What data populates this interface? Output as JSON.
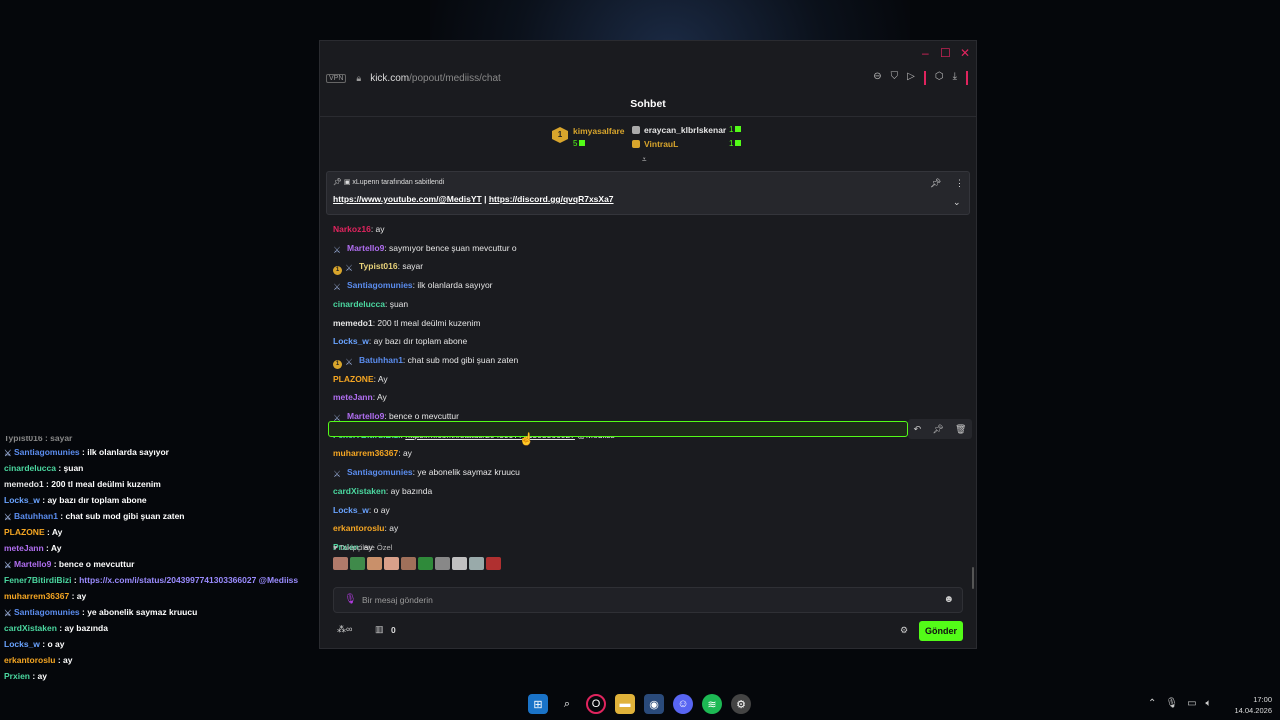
{
  "browser": {
    "vpn_label": "VPN",
    "url_domain": "kick.com",
    "url_path": "/popout/mediiss/chat"
  },
  "chat": {
    "title": "Sohbet",
    "leaderboard": [
      {
        "name": "kimyasalfare",
        "count": "5",
        "color": "#d8a52c"
      },
      {
        "name": "eraycan_klbrlskenar",
        "count": "1",
        "color": "#e6e6e6"
      },
      {
        "name": "VintrauL",
        "count": "1",
        "color": "#d8a52c"
      }
    ],
    "leaderboard_rank": "1",
    "pinned": {
      "by": "xLupenn tarafından sabitlendi",
      "link1": "https://www.youtube.com/@MedisYT",
      "separator": "|",
      "link2": "https://discord.gg/qvqR7xsXa7"
    },
    "messages": [
      {
        "user": "Narkoz16",
        "color": "#e0245e",
        "text": ": ay",
        "badges": []
      },
      {
        "user": "Martello9",
        "color": "#b06ef0",
        "text": ": saymıyor bence şuan mevcuttur o",
        "badges": [
          "mod"
        ]
      },
      {
        "user": "Typist016",
        "color": "#e8d27a",
        "text": ": sayar",
        "badges": [
          "sub",
          "mod"
        ]
      },
      {
        "user": "Santiagomunies",
        "color": "#5b8def",
        "text": ": ilk olanlarda sayıyor",
        "badges": [
          "mod"
        ]
      },
      {
        "user": "cinardelucca",
        "color": "#4bd8a0",
        "text": ": şuan",
        "badges": []
      },
      {
        "user": "memedo1",
        "color": "#e6e6e6",
        "text": ": 200 tl meal deülmi kuzenim",
        "badges": []
      },
      {
        "user": "Locks_w",
        "color": "#6aa3ff",
        "text": ": ay bazı dır toplam abone",
        "badges": []
      },
      {
        "user": "Batuhhan1",
        "color": "#5b8def",
        "text": ": chat sub mod gibi şuan zaten",
        "badges": [
          "sub",
          "mod"
        ]
      },
      {
        "user": "PLAZONE",
        "color": "#f5a623",
        "text": ": Ay",
        "badges": []
      },
      {
        "user": "meteJann",
        "color": "#b06ef0",
        "text": ": Ay",
        "badges": []
      },
      {
        "user": "Martello9",
        "color": "#b06ef0",
        "text": ": bence o mevcuttur",
        "badges": [
          "mod"
        ]
      },
      {
        "user": "Fener7BitirdiBizi",
        "color": "#4bd8a0",
        "text": ": ",
        "link": "https://x.com/i/status/2043997741303366027",
        "tail": " @Mediiss",
        "badges": []
      },
      {
        "user": "muharrem36367",
        "color": "#f5a623",
        "text": ": ay",
        "badges": []
      },
      {
        "user": "Santiagomunies",
        "color": "#5b8def",
        "text": ": ye abonelik saymaz kruucu",
        "badges": [
          "mod"
        ]
      },
      {
        "user": "cardXistaken",
        "color": "#4bd8a0",
        "text": ": ay bazında",
        "badges": []
      },
      {
        "user": "Locks_w",
        "color": "#6aa3ff",
        "text": ": o ay",
        "badges": []
      },
      {
        "user": "erkantoroslu",
        "color": "#f5a623",
        "text": ": ay",
        "badges": []
      },
      {
        "user": "Prxien",
        "color": "#4bd8a0",
        "text": ": ay",
        "badges": []
      }
    ],
    "emote_section": "Takipçilere Özel",
    "composer_placeholder": "Bir mesaj gönderin",
    "store_count": "0",
    "send_label": "Gönder"
  },
  "overlay": {
    "cut_line": "Typist016 : sayar",
    "lines": [
      {
        "user": "Santiagomunies",
        "color": "#5b8def",
        "text": " : ilk olanlarda sayıyor",
        "badge": "mod"
      },
      {
        "user": "cinardelucca",
        "color": "#4bd8a0",
        "text": " : şuan",
        "badge": ""
      },
      {
        "user": "memedo1",
        "color": "#e6e6e6",
        "text": " : 200 tl meal deülmi kuzenim",
        "badge": ""
      },
      {
        "user": "Locks_w",
        "color": "#6aa3ff",
        "text": " : ay bazı dır toplam abone",
        "badge": ""
      },
      {
        "user": "Batuhhan1",
        "color": "#5b8def",
        "text": " : chat sub mod gibi şuan zaten",
        "badge": "submod"
      },
      {
        "user": "PLAZONE",
        "color": "#f5a623",
        "text": " : Ay",
        "badge": ""
      },
      {
        "user": "meteJann",
        "color": "#b06ef0",
        "text": " : Ay",
        "badge": ""
      },
      {
        "user": "Martello9",
        "color": "#b06ef0",
        "text": " : bence o mevcuttur",
        "badge": "mod"
      },
      {
        "user": "Fener7BitirdiBizi",
        "color": "#4bd8a0",
        "text": " : ",
        "link": "https://x.com/i/status/2043997741303366027 @Mediiss",
        "badge": ""
      },
      {
        "user": "muharrem36367",
        "color": "#f5a623",
        "text": " : ay",
        "badge": ""
      },
      {
        "user": "Santiagomunies",
        "color": "#5b8def",
        "text": " : ye abonelik saymaz kruucu",
        "badge": "mod"
      },
      {
        "user": "cardXistaken",
        "color": "#4bd8a0",
        "text": " : ay bazında",
        "badge": ""
      },
      {
        "user": "Locks_w",
        "color": "#6aa3ff",
        "text": " : o ay",
        "badge": ""
      },
      {
        "user": "erkantoroslu",
        "color": "#f5a623",
        "text": " : ay",
        "badge": ""
      },
      {
        "user": "Prxien",
        "color": "#4bd8a0",
        "text": " : ay",
        "badge": ""
      }
    ]
  },
  "taskbar": {
    "time": "17:00",
    "date": "14.04.2026"
  },
  "colors": {
    "accent_green": "#53fc18",
    "accent_pink": "#e0245e"
  }
}
